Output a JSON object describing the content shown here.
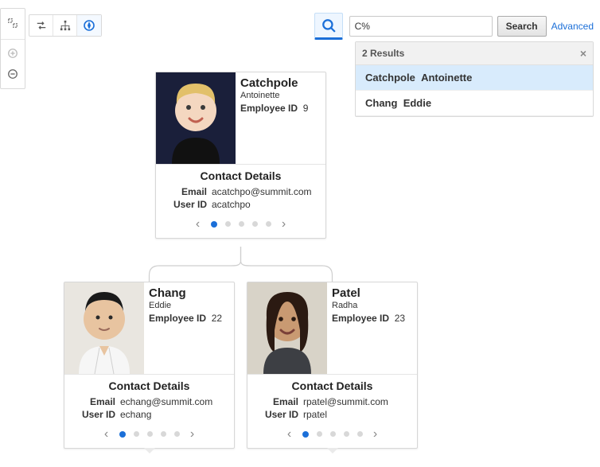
{
  "toolbar": {
    "items": [
      {
        "name": "arrange-icon"
      },
      {
        "name": "hierarchy-icon"
      },
      {
        "name": "compass-icon",
        "active": true
      }
    ],
    "side_items": [
      {
        "name": "select-icon"
      },
      {
        "name": "zoom-plus-icon"
      },
      {
        "name": "zoom-minus-icon"
      }
    ]
  },
  "search": {
    "query": "C%",
    "placeholder": "",
    "search_btn": "Search",
    "advanced": "Advanced",
    "results_label": "2 Results",
    "results": [
      {
        "last": "Catchpole",
        "first": "Antoinette",
        "highlight": true
      },
      {
        "last": "Chang",
        "first": "Eddie",
        "highlight": false
      }
    ],
    "close": "×"
  },
  "labels": {
    "contact_heading": "Contact Details",
    "email": "Email",
    "userid": "User ID",
    "empid": "Employee ID"
  },
  "nodes": {
    "root": {
      "last": "Catchpole",
      "first": "Antoinette",
      "emp_id": "9",
      "email": "acatchpo@summit.com",
      "userid": "acatchpo"
    },
    "left": {
      "last": "Chang",
      "first": "Eddie",
      "emp_id": "22",
      "email": "echang@summit.com",
      "userid": "echang"
    },
    "right": {
      "last": "Patel",
      "first": "Radha",
      "emp_id": "23",
      "email": "rpatel@summit.com",
      "userid": "rpatel"
    }
  }
}
